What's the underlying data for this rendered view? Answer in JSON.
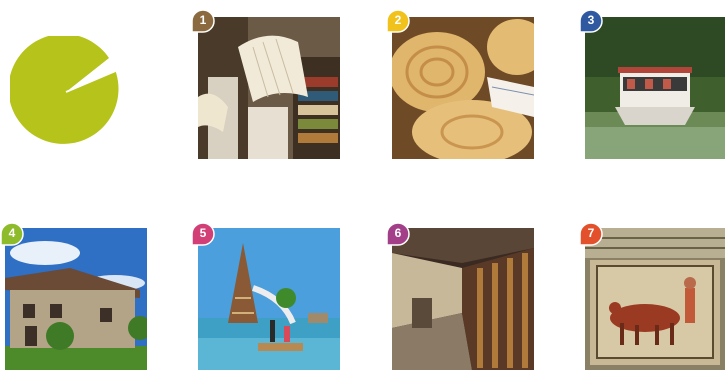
{
  "logo": {
    "color": "#b5c31a",
    "icon": "pie-logo-icon"
  },
  "tiles": [
    {
      "number": "1",
      "pin_color": "#8a6a3e",
      "subject": "books-library",
      "icon": "books-photo"
    },
    {
      "number": "2",
      "pin_color": "#f1c21b",
      "subject": "bread-pastries",
      "icon": "bread-photo"
    },
    {
      "number": "3",
      "pin_color": "#2f5aa1",
      "subject": "river-boat",
      "icon": "boat-photo"
    },
    {
      "number": "4",
      "pin_color": "#8dbb2a",
      "subject": "stone-farmhouse",
      "icon": "house-photo"
    },
    {
      "number": "5",
      "pin_color": "#d23f77",
      "subject": "water-playground",
      "icon": "park-photo"
    },
    {
      "number": "6",
      "pin_color": "#a23f88",
      "subject": "museum-corridor",
      "icon": "corridor-photo"
    },
    {
      "number": "7",
      "pin_color": "#e2502c",
      "subject": "roman-mosaic",
      "icon": "mosaic-photo"
    }
  ]
}
